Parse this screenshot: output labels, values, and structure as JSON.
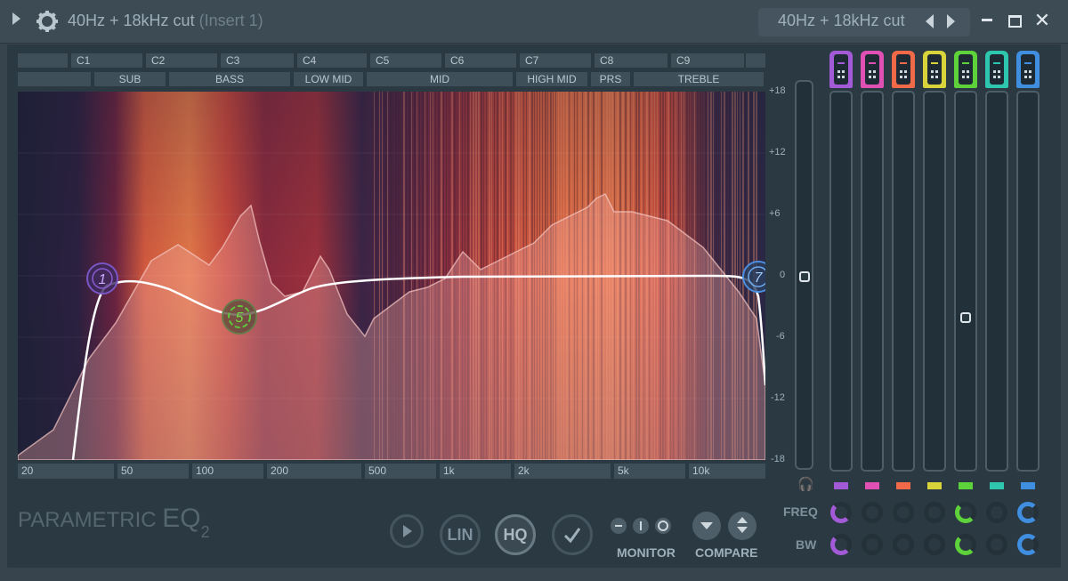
{
  "titlebar": {
    "title": "40Hz + 18kHz cut",
    "insert": "(Insert 1)",
    "preset_title": "40Hz + 18kHz cut"
  },
  "octaves": [
    "",
    "C1",
    "C2",
    "C3",
    "C4",
    "C5",
    "C6",
    "C7",
    "C8",
    "C9",
    ""
  ],
  "bands": [
    "",
    "SUB",
    "BASS",
    "LOW MID",
    "MID",
    "HIGH MID",
    "PRS",
    "TREBLE"
  ],
  "db_scale": [
    "+18",
    "+12",
    "+6",
    "0",
    "-6",
    "-12",
    "-18"
  ],
  "freq_scale": [
    "20",
    "50",
    "100",
    "200",
    "500",
    "1k",
    "2k",
    "5k",
    "10k"
  ],
  "nodes": [
    {
      "label": "1",
      "color": "#8c5bd1"
    },
    {
      "label": "5",
      "color": "#5ec83a"
    },
    {
      "label": "7",
      "color": "#4b8ee0"
    }
  ],
  "band_colors": [
    "#a25ad6",
    "#e04fb4",
    "#f06a4a",
    "#d8d33a",
    "#5ed23a",
    "#2fc6b0",
    "#3f8ee0"
  ],
  "row_labels": {
    "freq": "FREQ",
    "bw": "BW"
  },
  "brand": {
    "main": "PARAMETRIC ",
    "eq": "EQ",
    "num": "2"
  },
  "buttons": {
    "lin": "LIN",
    "hq": "HQ",
    "monitor": "MONITOR",
    "compare": "COMPARE"
  }
}
